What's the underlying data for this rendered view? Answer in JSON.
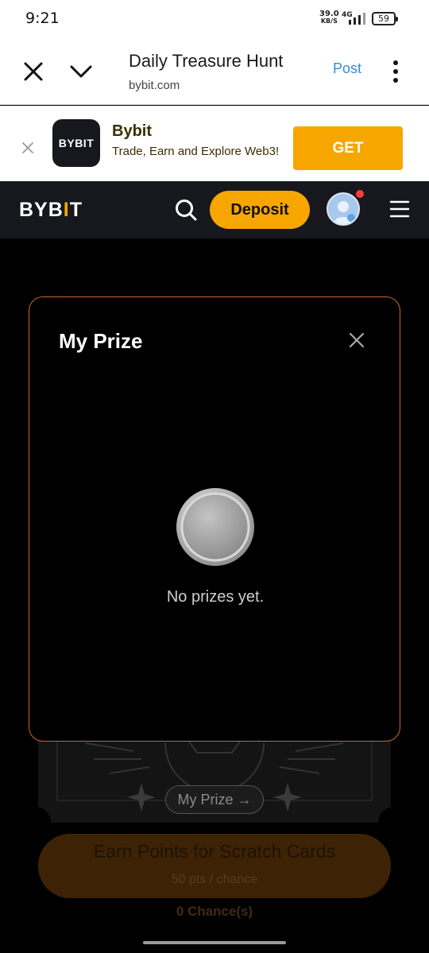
{
  "status_bar": {
    "time": "9:21",
    "net_speed_value": "39.0",
    "net_speed_unit": "KB/S",
    "network_type": "4G",
    "battery": "59"
  },
  "browser": {
    "page_title": "Daily Treasure Hunt",
    "domain": "bybit.com",
    "post_label": "Post"
  },
  "app_banner": {
    "logo_text": "BYBIT",
    "app_name": "Bybit",
    "description": "Trade, Earn and Explore Web3!",
    "get_label": "GET"
  },
  "site_header": {
    "logo_text_1": "BYB",
    "logo_text_accent": "I",
    "logo_text_2": "T",
    "deposit_label": "Deposit"
  },
  "modal": {
    "title": "My Prize",
    "empty_message": "No prizes yet."
  },
  "background_page": {
    "my_prize_label": "My Prize →",
    "earn_title": "Earn Points for Scratch Cards",
    "earn_subtitle": "50 pts / chance",
    "chances": "0 Chance(s)"
  },
  "colors": {
    "brand_accent": "#f7a600",
    "modal_border": "#c56a2a",
    "link_blue": "#2f8fd5"
  }
}
